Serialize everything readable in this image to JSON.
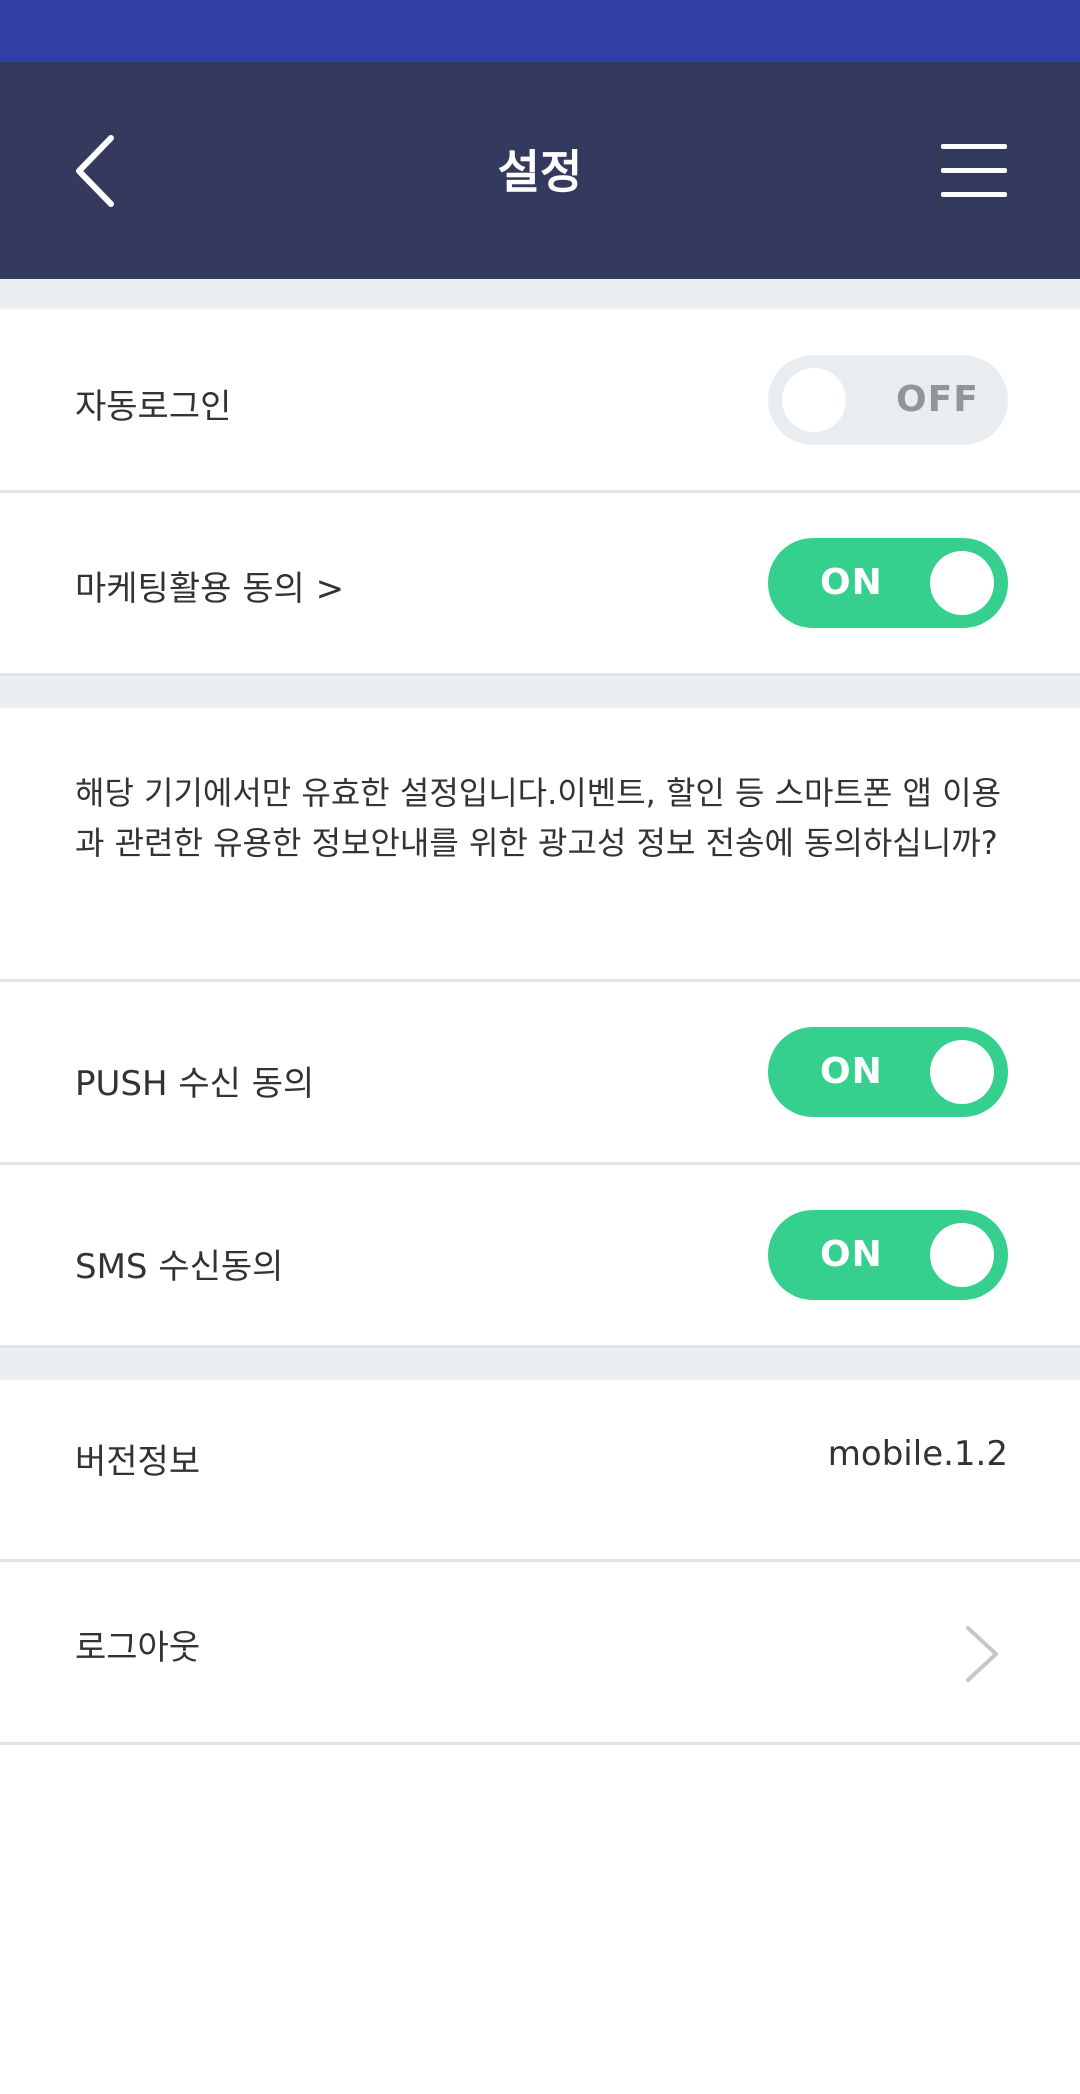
{
  "header": {
    "title": "설정",
    "back_icon": "chevron-left-icon",
    "menu_icon": "hamburger-menu-icon"
  },
  "settings": {
    "auto_login": {
      "label": "자동로그인",
      "state": "OFF"
    },
    "marketing": {
      "label": "마케팅활용 동의 >",
      "state": "ON"
    },
    "info": "해당 기기에서만 유효한 설정입니다.이벤트, 할인 등 스마트폰 앱 이용과 관련한 유용한 정보안내를 위한 광고성 정보 전송에 동의하십니까?",
    "push": {
      "label": "PUSH 수신 동의",
      "state": "ON"
    },
    "sms": {
      "label": "SMS 수신동의",
      "state": "ON"
    },
    "version": {
      "label": "버전정보",
      "value": "mobile.1.2"
    },
    "logout": {
      "label": "로그아웃",
      "icon": "chevron-right-icon"
    }
  },
  "colors": {
    "status_bar": "#313fa3",
    "app_bar": "#343a5e",
    "toggle_on": "#35d08d",
    "toggle_off": "#eaedef",
    "section_gap": "#eceff1"
  }
}
